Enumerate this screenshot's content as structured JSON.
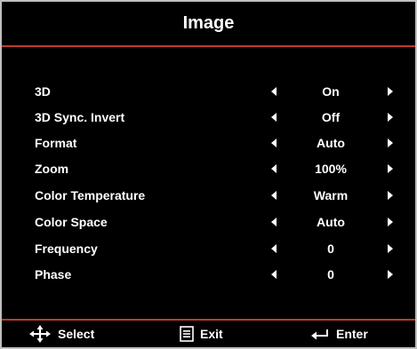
{
  "title": "Image",
  "menu": {
    "items": [
      {
        "label": "3D",
        "value": "On"
      },
      {
        "label": "3D Sync. Invert",
        "value": "Off"
      },
      {
        "label": "Format",
        "value": "Auto"
      },
      {
        "label": "Zoom",
        "value": "100%"
      },
      {
        "label": "Color Temperature",
        "value": "Warm"
      },
      {
        "label": "Color Space",
        "value": "Auto"
      },
      {
        "label": "Frequency",
        "value": "0"
      },
      {
        "label": "Phase",
        "value": "0"
      }
    ]
  },
  "footer": {
    "select_label": "Select",
    "exit_label": "Exit",
    "enter_label": "Enter",
    "select_icon": "move-arrows-icon",
    "exit_icon": "menu-icon",
    "enter_icon": "enter-return-icon"
  },
  "colors": {
    "background": "#000000",
    "accent_line": "#c0392b",
    "text": "#ffffff",
    "frame": "#bfbfbf"
  }
}
